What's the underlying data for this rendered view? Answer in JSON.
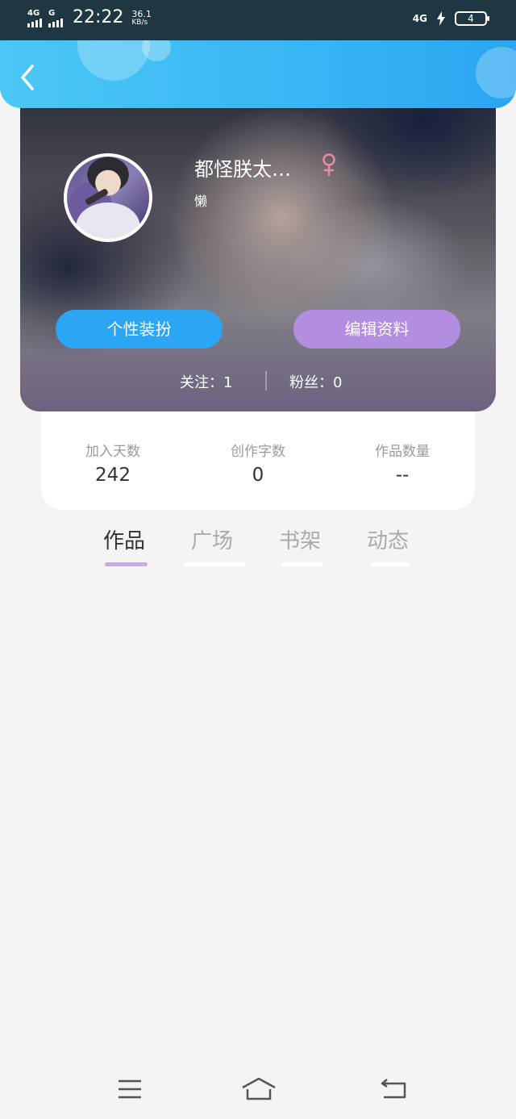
{
  "status_bar": {
    "net1": "4G",
    "net2": "G",
    "time": "22:22",
    "speed_value": "36.1",
    "speed_unit": "KB/s",
    "net3": "4G",
    "battery": "4"
  },
  "header": {
    "back_icon": "chevron-left-icon"
  },
  "profile": {
    "name": "都怪朕太…",
    "gender_icon": "female-icon",
    "bio": "懒",
    "buttons": {
      "dress_up": "个性装扮",
      "edit_profile": "编辑资料"
    },
    "follow": "关注：1",
    "fans": "粉丝：0",
    "colors": {
      "dress_button": "#2aa6f4",
      "edit_button": "#b38ee0",
      "gender_icon": "#e88aa8"
    }
  },
  "stats": [
    {
      "label": "加入天数",
      "value": "242"
    },
    {
      "label": "创作字数",
      "value": "0"
    },
    {
      "label": "作品数量",
      "value": "--"
    }
  ],
  "tabs": [
    {
      "label": "作品",
      "active": true
    },
    {
      "label": "广场",
      "active": false
    },
    {
      "label": "书架",
      "active": false
    },
    {
      "label": "动态",
      "active": false
    }
  ],
  "nav_bar": {
    "menu_icon": "menu-icon",
    "home_icon": "home-icon",
    "back_icon": "back-icon"
  }
}
